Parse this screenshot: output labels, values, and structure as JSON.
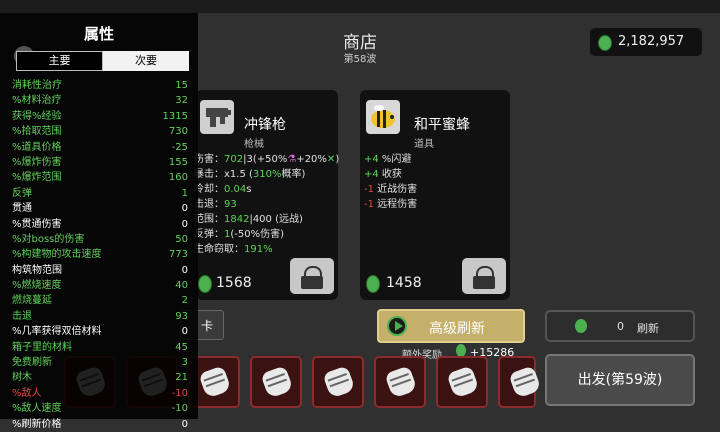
{
  "header": {
    "title": "商店",
    "wave": "第58波",
    "money": "2,182,957"
  },
  "cards": [
    {
      "name": "冲锋枪",
      "type": "枪械",
      "price": "1568",
      "icon": "gun-icon",
      "stats": [
        [
          [
            "伤害：",
            ""
          ],
          [
            "702",
            "g"
          ],
          [
            "|3(+50%",
            ""
          ],
          [
            "⚗",
            "p"
          ],
          [
            "+20%",
            ""
          ],
          [
            "✕",
            "g"
          ],
          [
            ")",
            ""
          ]
        ],
        [
          [
            "暴击：x1.5 (",
            ""
          ],
          [
            "310%",
            "g"
          ],
          [
            "概率)",
            ""
          ]
        ],
        [
          [
            "冷却：",
            ""
          ],
          [
            "0.04",
            "g"
          ],
          [
            "s",
            ""
          ]
        ],
        [
          [
            "击退：",
            ""
          ],
          [
            "93",
            "g"
          ]
        ],
        [
          [
            "范围：",
            ""
          ],
          [
            "1842",
            "g"
          ],
          [
            "|400 (远战)",
            ""
          ]
        ],
        [
          [
            "反弹：",
            ""
          ],
          [
            "1",
            "g"
          ],
          [
            "(-50%伤害)",
            ""
          ]
        ],
        [
          [
            "生命窃取：",
            ""
          ],
          [
            "191%",
            "g"
          ]
        ]
      ]
    },
    {
      "name": "和平蜜蜂",
      "type": "道具",
      "price": "1458",
      "icon": "bee-icon",
      "stats": [
        [
          [
            "+4",
            "g"
          ],
          [
            " %闪避",
            ""
          ]
        ],
        [
          [
            "+4",
            "g"
          ],
          [
            " 收获",
            ""
          ]
        ],
        [
          [
            "-1",
            "r"
          ],
          [
            " 近战伤害",
            ""
          ]
        ],
        [
          [
            "-1",
            "r"
          ],
          [
            " 远程伤害",
            ""
          ]
        ]
      ]
    }
  ],
  "refresh": {
    "label": "高级刷新",
    "bonus_label": "额外奖励",
    "bonus_value": "+15286"
  },
  "free_refresh": {
    "count": "0",
    "label": "刷新"
  },
  "depart": {
    "label": "出发(第59波)"
  },
  "card_button": {
    "label": "卡"
  },
  "attributes": {
    "title": "属性",
    "tabs": {
      "main": "主要",
      "sub": "次要"
    },
    "rows": [
      {
        "name": "消耗性治疗",
        "value": "15",
        "color": "#61d25b"
      },
      {
        "name": "%材料治疗",
        "value": "32",
        "color": "#61d25b"
      },
      {
        "name": "获得%经验",
        "value": "1315",
        "color": "#61d25b"
      },
      {
        "name": "%拾取范围",
        "value": "730",
        "color": "#61d25b"
      },
      {
        "name": "%道具价格",
        "value": "-25",
        "color": "#61d25b"
      },
      {
        "name": "%爆炸伤害",
        "value": "155",
        "color": "#61d25b"
      },
      {
        "name": "%爆炸范围",
        "value": "160",
        "color": "#61d25b"
      },
      {
        "name": "反弹",
        "value": "1",
        "color": "#61d25b"
      },
      {
        "name": "贯通",
        "value": "0",
        "color": "#ffffff"
      },
      {
        "name": "%贯通伤害",
        "value": "0",
        "color": "#ffffff"
      },
      {
        "name": "%对boss的伤害",
        "value": "50",
        "color": "#61d25b"
      },
      {
        "name": "%构建物的攻击速度",
        "value": "773",
        "color": "#61d25b"
      },
      {
        "name": "构筑物范围",
        "value": "0",
        "color": "#ffffff"
      },
      {
        "name": "%燃烧速度",
        "value": "40",
        "color": "#61d25b"
      },
      {
        "name": "燃烧蔓延",
        "value": "2",
        "color": "#61d25b"
      },
      {
        "name": "击退",
        "value": "93",
        "color": "#61d25b"
      },
      {
        "name": "%几率获得双倍材料",
        "value": "0",
        "color": "#ffffff"
      },
      {
        "name": "箱子里的材料",
        "value": "45",
        "color": "#61d25b"
      },
      {
        "name": "免费刷新",
        "value": "3",
        "color": "#61d25b"
      },
      {
        "name": "树木",
        "value": "21",
        "color": "#61d25b"
      },
      {
        "name": "%敌人",
        "value": "-10",
        "color": "#e0473f"
      },
      {
        "name": "%敌人速度",
        "value": "-10",
        "color": "#61d25b"
      },
      {
        "name": "%刷新价格",
        "value": "0",
        "color": "#ffffff"
      }
    ]
  }
}
